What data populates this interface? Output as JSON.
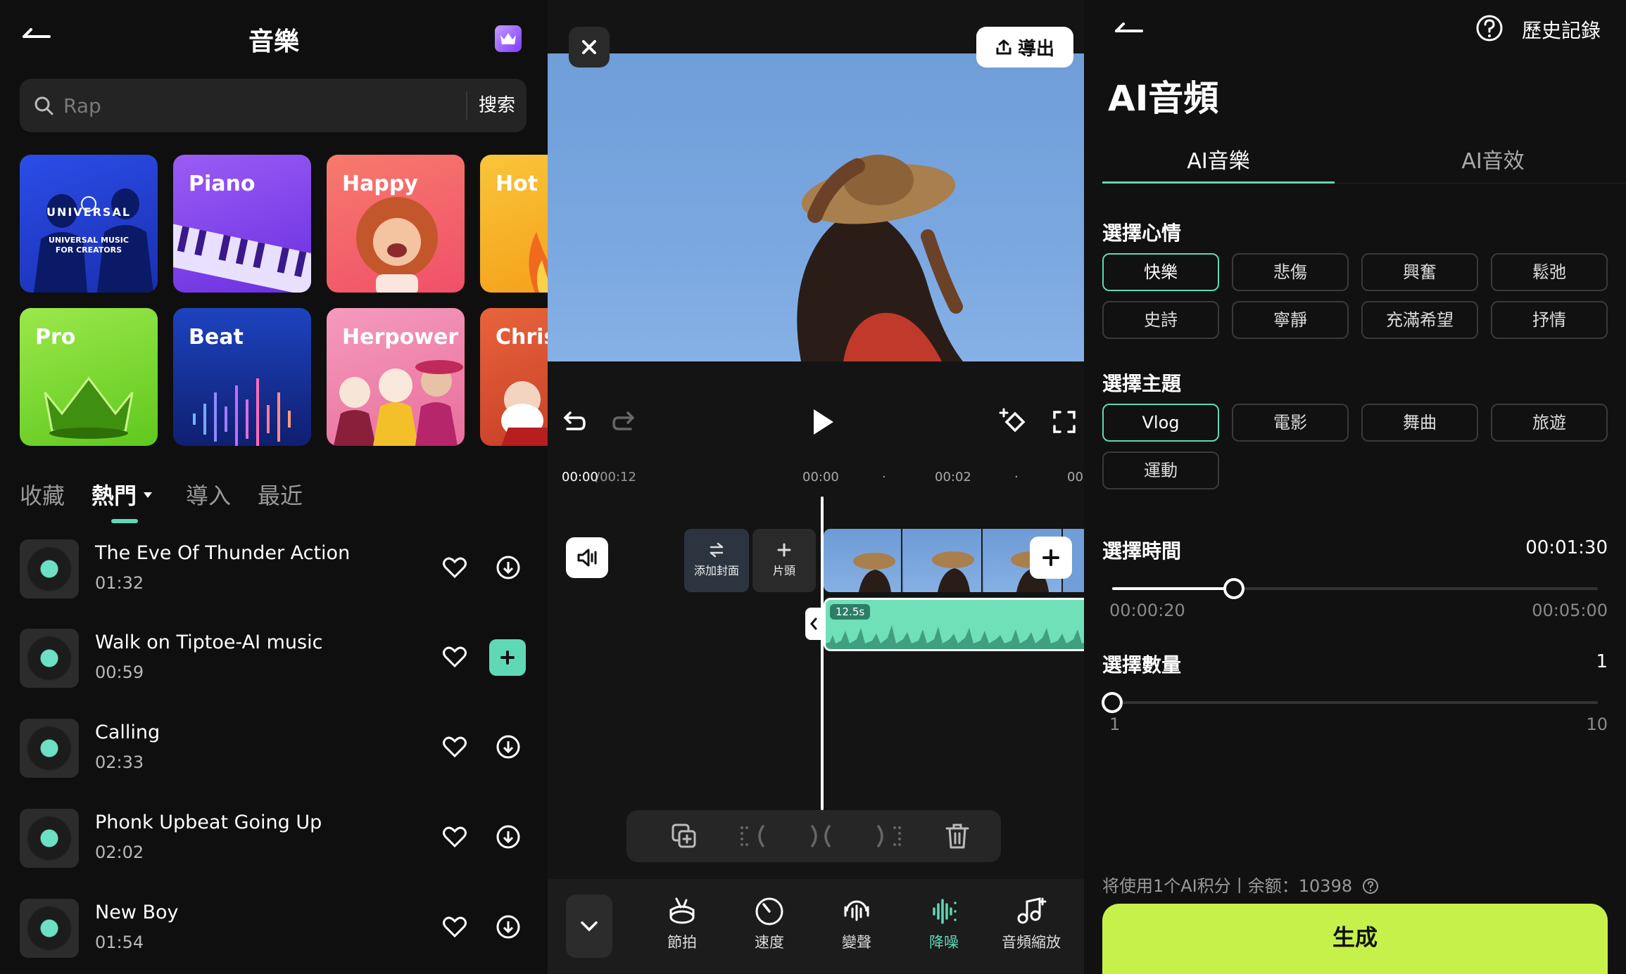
{
  "music_panel": {
    "title": "音樂",
    "search": {
      "placeholder": "Rap",
      "button": "搜索"
    },
    "tiles": [
      {
        "label": "",
        "logo_text": "UNIVERSAL",
        "logo_sub": "UNIVERSAL MUSIC FOR CREATORS",
        "color": "#1f3fd4"
      },
      {
        "label": "Piano",
        "color": "#8a4cf0"
      },
      {
        "label": "Happy",
        "color": "#f4616e"
      },
      {
        "label": "Hot",
        "color": "#f6b31e"
      },
      {
        "label": "Pro",
        "color": "#7fd838"
      },
      {
        "label": "Beat",
        "color": "#1f4dc8"
      },
      {
        "label": "Herpower",
        "color": "#f08ab0"
      },
      {
        "label": "Chris",
        "color": "#e0553a"
      }
    ],
    "tabs": [
      {
        "label": "收藏",
        "active": false
      },
      {
        "label": "熱門",
        "active": true
      },
      {
        "label": "導入",
        "active": false
      },
      {
        "label": "最近",
        "active": false
      }
    ],
    "songs": [
      {
        "title": "The Eve Of Thunder Action",
        "duration": "01:32",
        "action": "download"
      },
      {
        "title": "Walk on Tiptoe-AI music",
        "duration": "00:59",
        "action": "add"
      },
      {
        "title": "Calling",
        "duration": "02:33",
        "action": "download"
      },
      {
        "title": "Phonk Upbeat Going Up",
        "duration": "02:02",
        "action": "download"
      },
      {
        "title": "New Boy",
        "duration": "01:54",
        "action": "download"
      }
    ]
  },
  "editor": {
    "export_label": "導出",
    "time_current": "00:00",
    "time_total": "/00:12",
    "ruler": [
      "00:00",
      "00:02",
      "00"
    ],
    "cover_label": "添加封面",
    "head_label": "片頭",
    "audio_length": "12.5s",
    "bottom_tools": [
      {
        "label": "節拍",
        "icon": "beat-icon",
        "active": false
      },
      {
        "label": "速度",
        "icon": "speed-icon",
        "active": false
      },
      {
        "label": "變聲",
        "icon": "voice-change-icon",
        "active": false
      },
      {
        "label": "降噪",
        "icon": "denoise-icon",
        "active": true
      },
      {
        "label": "音頻縮放",
        "icon": "audio-scale-icon",
        "active": false
      }
    ]
  },
  "ai_panel": {
    "history": "歷史記錄",
    "title": "AI音頻",
    "tabs": [
      {
        "label": "AI音樂",
        "active": true
      },
      {
        "label": "AI音效",
        "active": false
      }
    ],
    "mood_label": "選擇心情",
    "moods": [
      {
        "label": "快樂",
        "selected": true
      },
      {
        "label": "悲傷",
        "selected": false
      },
      {
        "label": "興奮",
        "selected": false
      },
      {
        "label": "鬆弛",
        "selected": false
      },
      {
        "label": "史詩",
        "selected": false
      },
      {
        "label": "寧靜",
        "selected": false
      },
      {
        "label": "充滿希望",
        "selected": false
      },
      {
        "label": "抒情",
        "selected": false
      }
    ],
    "theme_label": "選擇主題",
    "themes": [
      {
        "label": "Vlog",
        "selected": true
      },
      {
        "label": "電影",
        "selected": false
      },
      {
        "label": "舞曲",
        "selected": false
      },
      {
        "label": "旅遊",
        "selected": false
      },
      {
        "label": "運動",
        "selected": false
      }
    ],
    "time_label": "選擇時間",
    "time_value": "00:01:30",
    "time_min": "00:00:20",
    "time_max": "00:05:00",
    "time_fraction": 0.25,
    "count_label": "選擇數量",
    "count_value": "1",
    "count_min": "1",
    "count_max": "10",
    "count_fraction": 0.0,
    "quota_text": "将使用1个AI积分丨余额：10398",
    "generate_label": "生成",
    "accent_color": "#5fd8b6",
    "generate_color": "#c6f14a"
  }
}
